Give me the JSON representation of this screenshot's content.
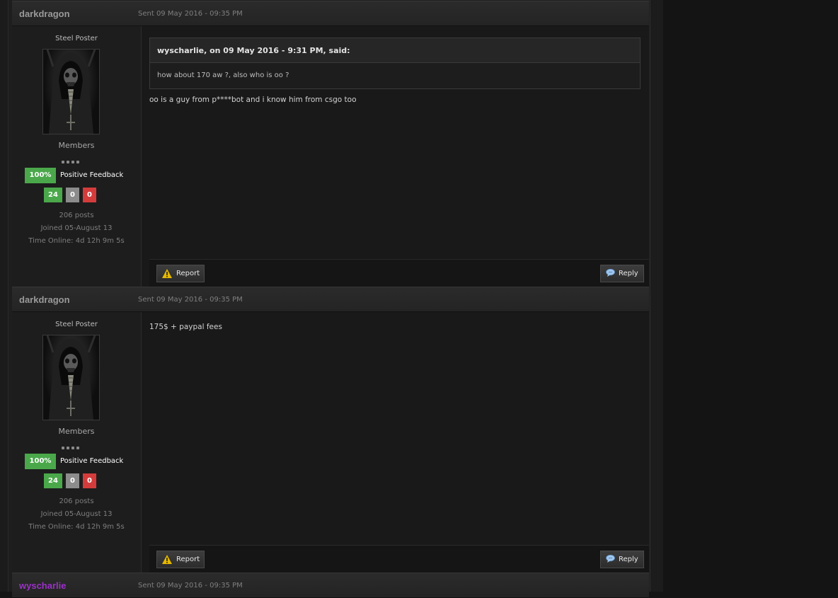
{
  "posts": [
    {
      "author": "darkdragon",
      "sent": "Sent 09 May 2016 - 09:35 PM",
      "user_title": "Steel Poster",
      "group": "Members",
      "feedback_percent": "100%",
      "feedback_label": "Positive Feedback",
      "feedback_positive": "24",
      "feedback_neutral": "0",
      "feedback_negative": "0",
      "posts_count": "206 posts",
      "joined": "Joined 05-August 13",
      "time_online": "Time Online: 4d 12h 9m 5s",
      "quote": {
        "cite": "wyscharlie, on 09 May 2016 - 9:31 PM, said:",
        "text": "how about 170 aw ?, also who is oo ?"
      },
      "message": "oo is a guy from p****bot and i know him from csgo too",
      "report_label": "Report",
      "reply_label": "Reply"
    },
    {
      "author": "darkdragon",
      "sent": "Sent 09 May 2016 - 09:35 PM",
      "user_title": "Steel Poster",
      "group": "Members",
      "feedback_percent": "100%",
      "feedback_label": "Positive Feedback",
      "feedback_positive": "24",
      "feedback_neutral": "0",
      "feedback_negative": "0",
      "posts_count": "206 posts",
      "joined": "Joined 05-August 13",
      "time_online": "Time Online: 4d 12h 9m 5s",
      "message": "175$ + paypal fees",
      "report_label": "Report",
      "reply_label": "Reply"
    },
    {
      "author": "wyscharlie",
      "author_color": "#9b30c8",
      "sent": "Sent 09 May 2016 - 09:35 PM"
    }
  ],
  "icons": {
    "report": "warning-icon",
    "reply": "speech-bubble-icon"
  }
}
